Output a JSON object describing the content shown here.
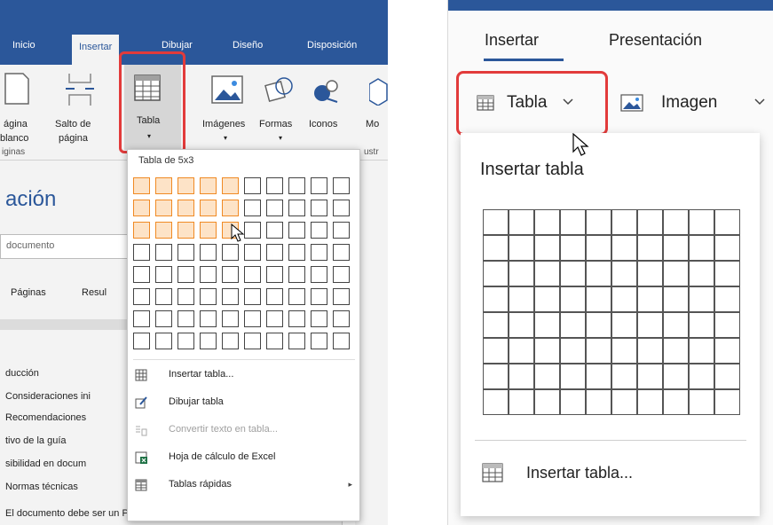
{
  "left_panel": {
    "tabs": [
      {
        "label": "Inicio",
        "active": false
      },
      {
        "label": "Insertar",
        "active": true
      },
      {
        "label": "Dibujar",
        "active": false
      },
      {
        "label": "Diseño",
        "active": false
      },
      {
        "label": "Disposición",
        "active": false
      }
    ],
    "ribbon": {
      "blank_page_l1": "ágina",
      "blank_page_l2": "blanco",
      "page_break_l1": "Salto de",
      "page_break_l2": "página",
      "table": "Tabla",
      "images": "Imágenes",
      "shapes": "Formas",
      "icons": "Iconos",
      "models_clip": "Mo",
      "group_pages": "iginas",
      "group_illus": "ustr"
    },
    "doc": {
      "heading": "ación",
      "search_placeholder": "documento",
      "tab_pages": "Páginas",
      "tab_results": "Resul",
      "outline": [
        "ducción",
        "Consideraciones ini",
        "Recomendaciones",
        "tivo de la guía",
        "sibilidad en docum",
        "Normas técnicas",
        "El documento debe ser un PDF etiquetado (\""
      ]
    },
    "dropdown": {
      "title": "Tabla de 5x3",
      "rows": 8,
      "cols": 10,
      "selected_cols": 5,
      "selected_rows": 3,
      "items": [
        {
          "label": "Insertar tabla...",
          "icon": "table-icon",
          "enabled": true
        },
        {
          "label": "Dibujar tabla",
          "icon": "pencil-table-icon",
          "enabled": true
        },
        {
          "label": "Convertir texto en tabla...",
          "icon": "convert-text-icon",
          "enabled": false
        },
        {
          "label": "Hoja de cálculo de Excel",
          "icon": "excel-icon",
          "enabled": true
        },
        {
          "label": "Tablas rápidas",
          "icon": "quick-tables-icon",
          "enabled": true,
          "submenu": true
        }
      ]
    }
  },
  "right_panel": {
    "tabs": [
      {
        "label": "Insertar",
        "active": true
      },
      {
        "label": "Presentación",
        "active": false
      }
    ],
    "toolbar": {
      "table": "Tabla",
      "image": "Imagen"
    },
    "dropdown": {
      "title": "Insertar tabla",
      "rows": 8,
      "cols": 10,
      "footer": "Insertar tabla..."
    }
  },
  "colors": {
    "brand_blue": "#2b579a",
    "highlight_red": "#e23b3b",
    "selection_orange": "#f08a24"
  }
}
